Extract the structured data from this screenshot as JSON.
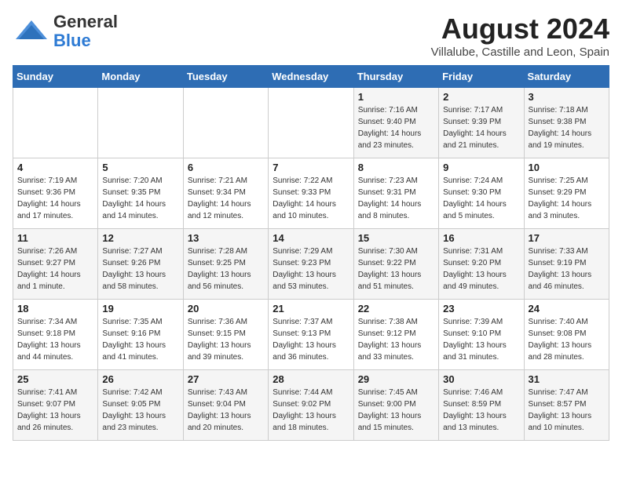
{
  "header": {
    "logo_general": "General",
    "logo_blue": "Blue",
    "month_year": "August 2024",
    "location": "Villalube, Castille and Leon, Spain"
  },
  "weekdays": [
    "Sunday",
    "Monday",
    "Tuesday",
    "Wednesday",
    "Thursday",
    "Friday",
    "Saturday"
  ],
  "weeks": [
    [
      {
        "day": "",
        "info": ""
      },
      {
        "day": "",
        "info": ""
      },
      {
        "day": "",
        "info": ""
      },
      {
        "day": "",
        "info": ""
      },
      {
        "day": "1",
        "info": "Sunrise: 7:16 AM\nSunset: 9:40 PM\nDaylight: 14 hours\nand 23 minutes."
      },
      {
        "day": "2",
        "info": "Sunrise: 7:17 AM\nSunset: 9:39 PM\nDaylight: 14 hours\nand 21 minutes."
      },
      {
        "day": "3",
        "info": "Sunrise: 7:18 AM\nSunset: 9:38 PM\nDaylight: 14 hours\nand 19 minutes."
      }
    ],
    [
      {
        "day": "4",
        "info": "Sunrise: 7:19 AM\nSunset: 9:36 PM\nDaylight: 14 hours\nand 17 minutes."
      },
      {
        "day": "5",
        "info": "Sunrise: 7:20 AM\nSunset: 9:35 PM\nDaylight: 14 hours\nand 14 minutes."
      },
      {
        "day": "6",
        "info": "Sunrise: 7:21 AM\nSunset: 9:34 PM\nDaylight: 14 hours\nand 12 minutes."
      },
      {
        "day": "7",
        "info": "Sunrise: 7:22 AM\nSunset: 9:33 PM\nDaylight: 14 hours\nand 10 minutes."
      },
      {
        "day": "8",
        "info": "Sunrise: 7:23 AM\nSunset: 9:31 PM\nDaylight: 14 hours\nand 8 minutes."
      },
      {
        "day": "9",
        "info": "Sunrise: 7:24 AM\nSunset: 9:30 PM\nDaylight: 14 hours\nand 5 minutes."
      },
      {
        "day": "10",
        "info": "Sunrise: 7:25 AM\nSunset: 9:29 PM\nDaylight: 14 hours\nand 3 minutes."
      }
    ],
    [
      {
        "day": "11",
        "info": "Sunrise: 7:26 AM\nSunset: 9:27 PM\nDaylight: 14 hours\nand 1 minute."
      },
      {
        "day": "12",
        "info": "Sunrise: 7:27 AM\nSunset: 9:26 PM\nDaylight: 13 hours\nand 58 minutes."
      },
      {
        "day": "13",
        "info": "Sunrise: 7:28 AM\nSunset: 9:25 PM\nDaylight: 13 hours\nand 56 minutes."
      },
      {
        "day": "14",
        "info": "Sunrise: 7:29 AM\nSunset: 9:23 PM\nDaylight: 13 hours\nand 53 minutes."
      },
      {
        "day": "15",
        "info": "Sunrise: 7:30 AM\nSunset: 9:22 PM\nDaylight: 13 hours\nand 51 minutes."
      },
      {
        "day": "16",
        "info": "Sunrise: 7:31 AM\nSunset: 9:20 PM\nDaylight: 13 hours\nand 49 minutes."
      },
      {
        "day": "17",
        "info": "Sunrise: 7:33 AM\nSunset: 9:19 PM\nDaylight: 13 hours\nand 46 minutes."
      }
    ],
    [
      {
        "day": "18",
        "info": "Sunrise: 7:34 AM\nSunset: 9:18 PM\nDaylight: 13 hours\nand 44 minutes."
      },
      {
        "day": "19",
        "info": "Sunrise: 7:35 AM\nSunset: 9:16 PM\nDaylight: 13 hours\nand 41 minutes."
      },
      {
        "day": "20",
        "info": "Sunrise: 7:36 AM\nSunset: 9:15 PM\nDaylight: 13 hours\nand 39 minutes."
      },
      {
        "day": "21",
        "info": "Sunrise: 7:37 AM\nSunset: 9:13 PM\nDaylight: 13 hours\nand 36 minutes."
      },
      {
        "day": "22",
        "info": "Sunrise: 7:38 AM\nSunset: 9:12 PM\nDaylight: 13 hours\nand 33 minutes."
      },
      {
        "day": "23",
        "info": "Sunrise: 7:39 AM\nSunset: 9:10 PM\nDaylight: 13 hours\nand 31 minutes."
      },
      {
        "day": "24",
        "info": "Sunrise: 7:40 AM\nSunset: 9:08 PM\nDaylight: 13 hours\nand 28 minutes."
      }
    ],
    [
      {
        "day": "25",
        "info": "Sunrise: 7:41 AM\nSunset: 9:07 PM\nDaylight: 13 hours\nand 26 minutes."
      },
      {
        "day": "26",
        "info": "Sunrise: 7:42 AM\nSunset: 9:05 PM\nDaylight: 13 hours\nand 23 minutes."
      },
      {
        "day": "27",
        "info": "Sunrise: 7:43 AM\nSunset: 9:04 PM\nDaylight: 13 hours\nand 20 minutes."
      },
      {
        "day": "28",
        "info": "Sunrise: 7:44 AM\nSunset: 9:02 PM\nDaylight: 13 hours\nand 18 minutes."
      },
      {
        "day": "29",
        "info": "Sunrise: 7:45 AM\nSunset: 9:00 PM\nDaylight: 13 hours\nand 15 minutes."
      },
      {
        "day": "30",
        "info": "Sunrise: 7:46 AM\nSunset: 8:59 PM\nDaylight: 13 hours\nand 13 minutes."
      },
      {
        "day": "31",
        "info": "Sunrise: 7:47 AM\nSunset: 8:57 PM\nDaylight: 13 hours\nand 10 minutes."
      }
    ]
  ]
}
